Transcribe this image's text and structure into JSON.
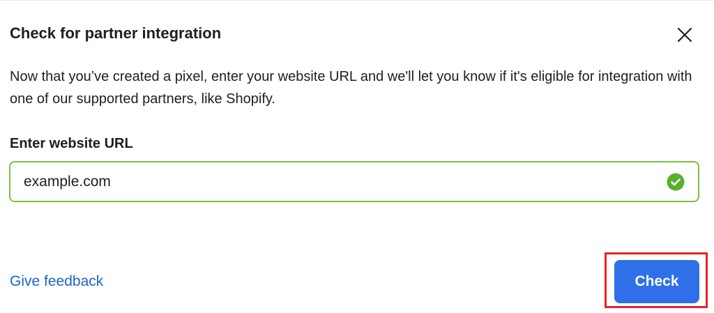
{
  "dialog": {
    "title": "Check for partner integration",
    "close_icon": "close-icon",
    "description": "Now that you’ve created a pixel, enter your website URL and we'll let you know if it's eligible for integration with one of our supported partners, like Shopify.",
    "url_field": {
      "label": "Enter website URL",
      "value": "example.com",
      "status_icon": "check-circle-icon",
      "status": "valid"
    },
    "feedback_link": "Give feedback",
    "check_button": "Check"
  },
  "colors": {
    "primary_button": "#2f6fe8",
    "link": "#1b64c8",
    "valid_border": "#7ac142",
    "valid_icon": "#5ab02c",
    "highlight": "#e4222f",
    "text": "#1c1e21"
  }
}
